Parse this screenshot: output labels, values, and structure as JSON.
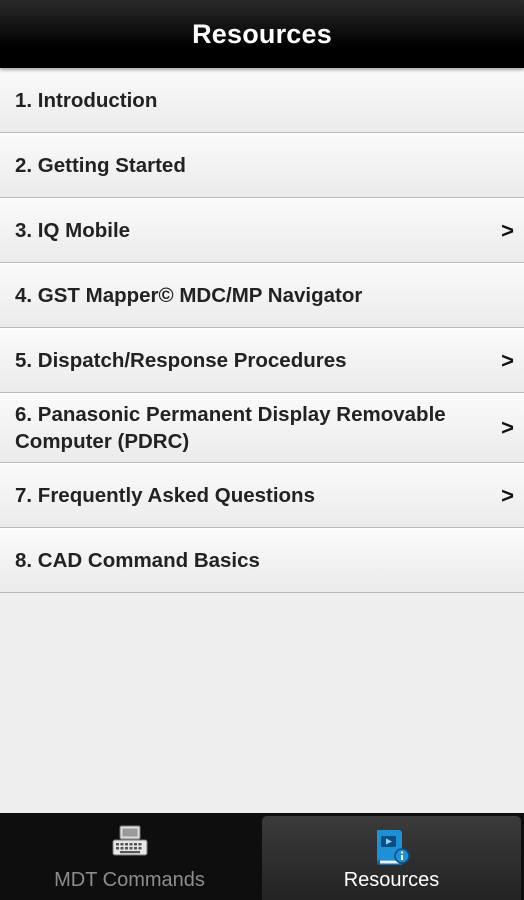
{
  "header": {
    "title": "Resources"
  },
  "items": [
    {
      "label": "1. Introduction",
      "has_chevron": false
    },
    {
      "label": "2. Getting Started",
      "has_chevron": false
    },
    {
      "label": "3. IQ Mobile",
      "has_chevron": true
    },
    {
      "label": "4. GST Mapper© MDC/MP Navigator",
      "has_chevron": false
    },
    {
      "label": "5. Dispatch/Response Procedures",
      "has_chevron": true
    },
    {
      "label": "6. Panasonic Permanent Display Removable Computer (PDRC)",
      "has_chevron": true
    },
    {
      "label": "7. Frequently Asked Questions",
      "has_chevron": true
    },
    {
      "label": "8. CAD Command Basics",
      "has_chevron": false
    }
  ],
  "chevron_glyph": ">",
  "tabs": [
    {
      "label": "MDT Commands",
      "icon": "keyboard-terminal-icon",
      "active": false
    },
    {
      "label": "Resources",
      "icon": "book-info-icon",
      "active": true
    }
  ],
  "colors": {
    "accent": "#1e90d6"
  }
}
